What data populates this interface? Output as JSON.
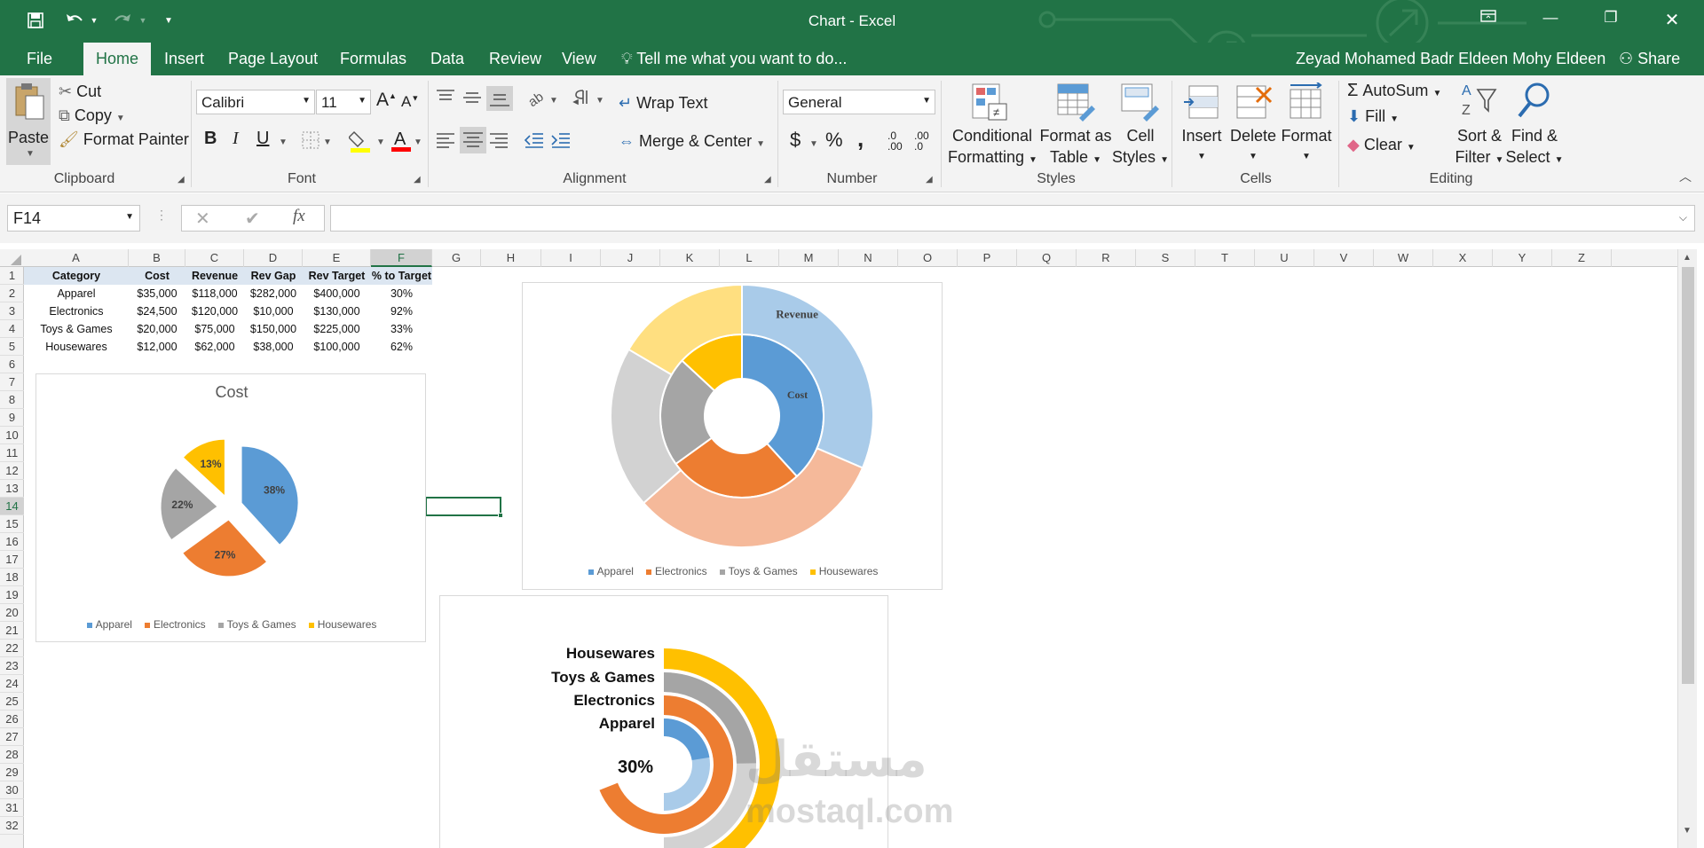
{
  "window": {
    "title": "Chart - Excel",
    "user": "Zeyad Mohamed Badr Eldeen Mohy Eldeen",
    "share": "Share"
  },
  "tabs": [
    "File",
    "Home",
    "Insert",
    "Page Layout",
    "Formulas",
    "Data",
    "Review",
    "View"
  ],
  "tell_me": "Tell me what you want to do...",
  "clipboard": {
    "paste": "Paste",
    "cut": "Cut",
    "copy": "Copy",
    "format_painter": "Format Painter",
    "label": "Clipboard"
  },
  "font": {
    "name": "Calibri",
    "size": "11",
    "bold": "B",
    "italic": "I",
    "underline": "U",
    "label": "Font"
  },
  "alignment": {
    "wrap": "Wrap Text",
    "merge": "Merge & Center",
    "label": "Alignment"
  },
  "number": {
    "format": "General",
    "currency": "$",
    "percent": "%",
    "comma": ",",
    "inc_dec": ".0 .00",
    "dec_dec": ".00 .0",
    "label": "Number"
  },
  "styles": {
    "conditional": [
      "Conditional",
      "Formatting"
    ],
    "format_table": [
      "Format as",
      "Table"
    ],
    "cell_styles": [
      "Cell",
      "Styles"
    ],
    "label": "Styles"
  },
  "cells": {
    "insert": "Insert",
    "delete": "Delete",
    "format": "Format",
    "label": "Cells"
  },
  "editing": {
    "autosum": "AutoSum",
    "fill": "Fill",
    "clear": "Clear",
    "sort": [
      "Sort &",
      "Filter"
    ],
    "find": [
      "Find &",
      "Select"
    ],
    "label": "Editing"
  },
  "formula_bar": {
    "name_box": "F14",
    "fx": "fx",
    "value": ""
  },
  "columns": [
    "A",
    "B",
    "C",
    "D",
    "E",
    "F",
    "G",
    "H",
    "I",
    "J",
    "K",
    "L",
    "M",
    "N",
    "O",
    "P",
    "Q",
    "R",
    "S",
    "T",
    "U",
    "V",
    "W",
    "X",
    "Y",
    "Z"
  ],
  "rows": [
    "1",
    "2",
    "3",
    "4",
    "5",
    "6",
    "7",
    "8",
    "9",
    "10",
    "11",
    "12",
    "13",
    "14",
    "15",
    "16",
    "17",
    "18",
    "19",
    "20",
    "21",
    "22",
    "23",
    "24",
    "25",
    "26",
    "27",
    "28",
    "29",
    "30",
    "31",
    "32"
  ],
  "selected_cell": {
    "col": "F",
    "row": "14"
  },
  "table": {
    "headers": [
      "Category",
      "Cost",
      "Revenue",
      "Rev Gap",
      "Rev Target",
      "% to Target"
    ],
    "rows": [
      [
        "Apparel",
        "$35,000",
        "$118,000",
        "$282,000",
        "$400,000",
        "30%"
      ],
      [
        "Electronics",
        "$24,500",
        "$120,000",
        "$10,000",
        "$130,000",
        "92%"
      ],
      [
        "Toys & Games",
        "$20,000",
        "$75,000",
        "$150,000",
        "$225,000",
        "33%"
      ],
      [
        "Housewares",
        "$12,000",
        "$62,000",
        "$38,000",
        "$100,000",
        "62%"
      ]
    ]
  },
  "colors": {
    "apparel": "#5b9bd5",
    "electronics": "#ed7d31",
    "toys": "#a5a5a5",
    "housewares": "#ffc000",
    "apparel_light": "#a9cbe9",
    "electronics_light": "#f5b99a",
    "toys_light": "#d2d2d2",
    "housewares_light": "#ffdf80",
    "excel_green": "#217346"
  },
  "chart_data": [
    {
      "type": "pie",
      "title": "Cost",
      "categories": [
        "Apparel",
        "Electronics",
        "Toys & Games",
        "Housewares"
      ],
      "values": [
        35000,
        24500,
        20000,
        12000
      ],
      "data_labels": [
        "38%",
        "27%",
        "22%",
        "13%"
      ],
      "legend": "bottom",
      "exploded": true
    },
    {
      "type": "doughnut",
      "title": "",
      "categories": [
        "Apparel",
        "Electronics",
        "Toys & Games",
        "Housewares"
      ],
      "series": [
        {
          "name": "Cost",
          "values": [
            35000,
            24500,
            20000,
            12000
          ]
        },
        {
          "name": "Revenue",
          "values": [
            118000,
            120000,
            75000,
            62000
          ]
        }
      ],
      "legend": "bottom"
    },
    {
      "type": "radial-bar",
      "title": "",
      "categories": [
        "Housewares",
        "Toys & Games",
        "Electronics",
        "Apparel"
      ],
      "values": [
        62,
        33,
        92,
        30
      ],
      "unit": "%",
      "center_label": "30%"
    }
  ],
  "watermark": {
    "arabic": "مستقل",
    "latin": "mostaql.com"
  }
}
